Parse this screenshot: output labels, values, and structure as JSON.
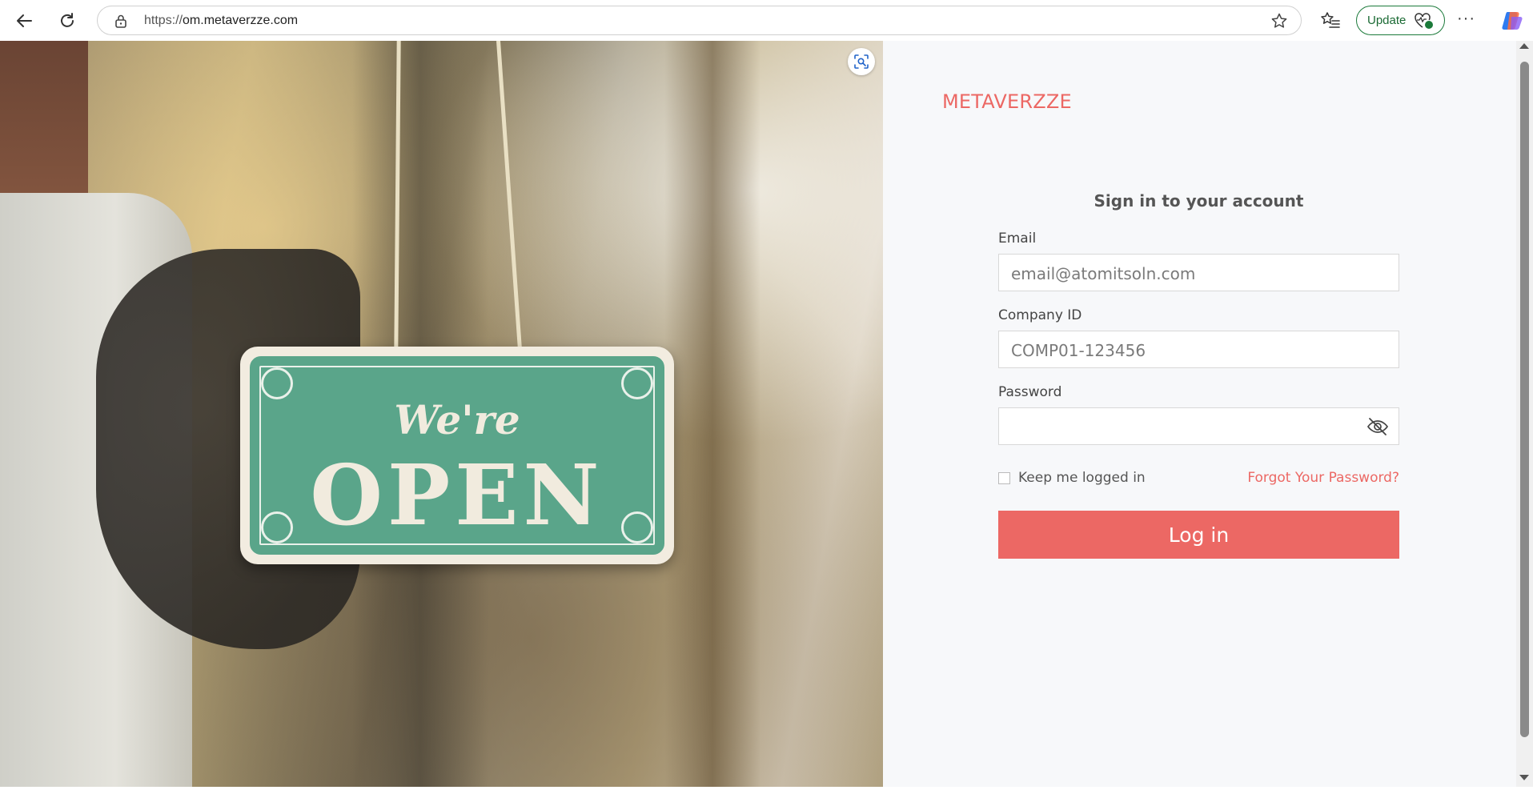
{
  "browser": {
    "url_scheme": "https://",
    "url_host": "om.metaverzze.com",
    "update_label": "Update",
    "update_badge": "1",
    "more_label": "···"
  },
  "hero": {
    "sign_line1": "We're",
    "sign_line2": "OPEN"
  },
  "brand": {
    "name": "METAVERZZE",
    "color": "#ec6864"
  },
  "login": {
    "title": "Sign in to your account",
    "email_label": "Email",
    "email_placeholder": "email@atomitsoln.com",
    "company_label": "Company ID",
    "company_placeholder": "COMP01-123456",
    "password_label": "Password",
    "password_value": "",
    "keep_logged_in_label": "Keep me logged in",
    "keep_logged_in_checked": false,
    "forgot_label": "Forgot Your Password?",
    "submit_label": "Log in"
  },
  "icons": [
    "back-icon",
    "reload-icon",
    "lock-icon",
    "star-icon",
    "favorites-icon",
    "heart-pulse-icon",
    "more-icon",
    "copilot-icon",
    "visual-search-icon",
    "eye-off-icon"
  ]
}
